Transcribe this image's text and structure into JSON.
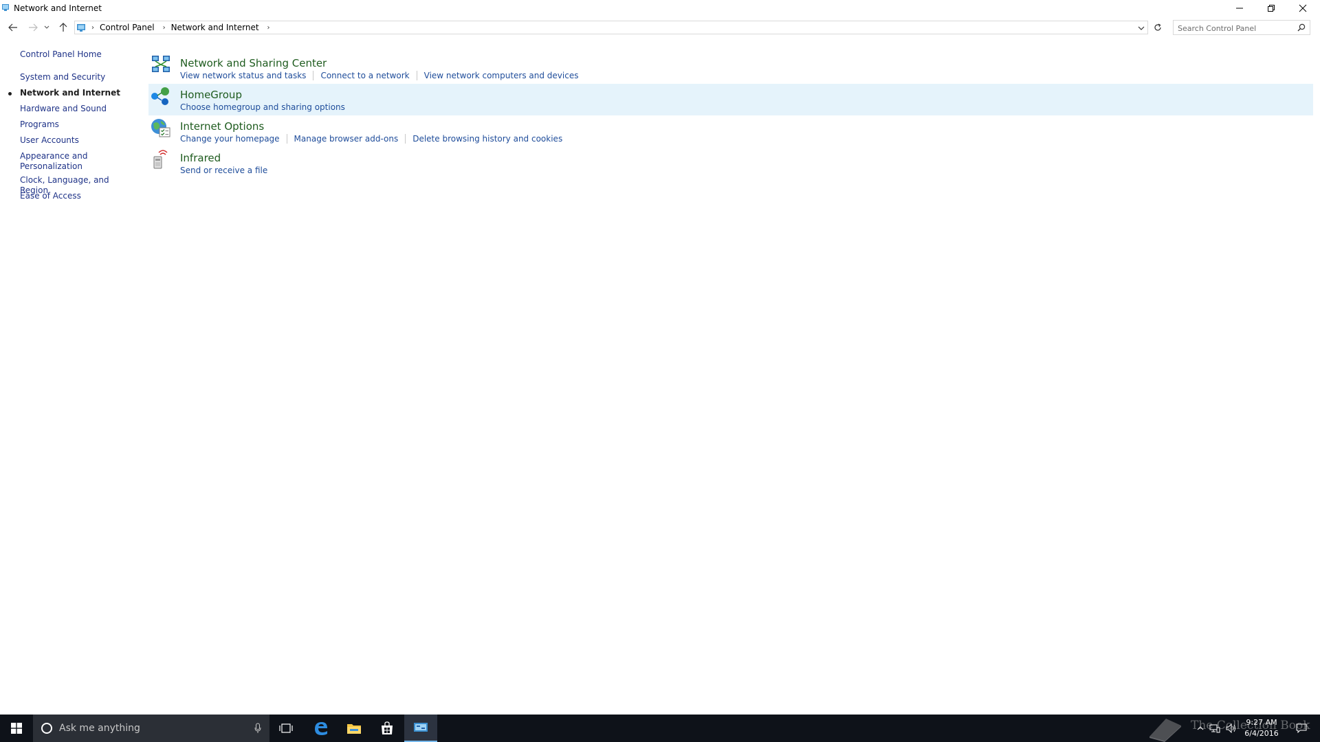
{
  "window": {
    "title": "Network and Internet"
  },
  "addressbar": {
    "crumbs": [
      "Control Panel",
      "Network and Internet"
    ]
  },
  "search": {
    "placeholder": "Search Control Panel"
  },
  "sidebar": {
    "items": [
      {
        "label": "Control Panel Home"
      },
      {
        "label": "System and Security"
      },
      {
        "label": "Network and Internet",
        "active": true
      },
      {
        "label": "Hardware and Sound"
      },
      {
        "label": "Programs"
      },
      {
        "label": "User Accounts"
      },
      {
        "label": "Appearance and Personalization"
      },
      {
        "label": "Clock, Language, and Region"
      },
      {
        "label": "Ease of Access"
      }
    ]
  },
  "categories": [
    {
      "title": "Network and Sharing Center",
      "icon": "network-sharing-icon",
      "links": [
        "View network status and tasks",
        "Connect to a network",
        "View network computers and devices"
      ]
    },
    {
      "title": "HomeGroup",
      "icon": "homegroup-icon",
      "links": [
        "Choose homegroup and sharing options"
      ]
    },
    {
      "title": "Internet Options",
      "icon": "internet-options-icon",
      "links": [
        "Change your homepage",
        "Manage browser add-ons",
        "Delete browsing history and cookies"
      ]
    },
    {
      "title": "Infrared",
      "icon": "infrared-icon",
      "links": [
        "Send or receive a file"
      ]
    }
  ],
  "taskbar": {
    "search_placeholder": "Ask me anything",
    "time": "9:27 AM",
    "date": "6/4/2016",
    "watermark": "The Collection Book"
  },
  "colors": {
    "taskbar": "#0e1219",
    "highlight": "#e5f3fb",
    "link": "#1e4c9a",
    "category_title": "#1e5b1e"
  }
}
